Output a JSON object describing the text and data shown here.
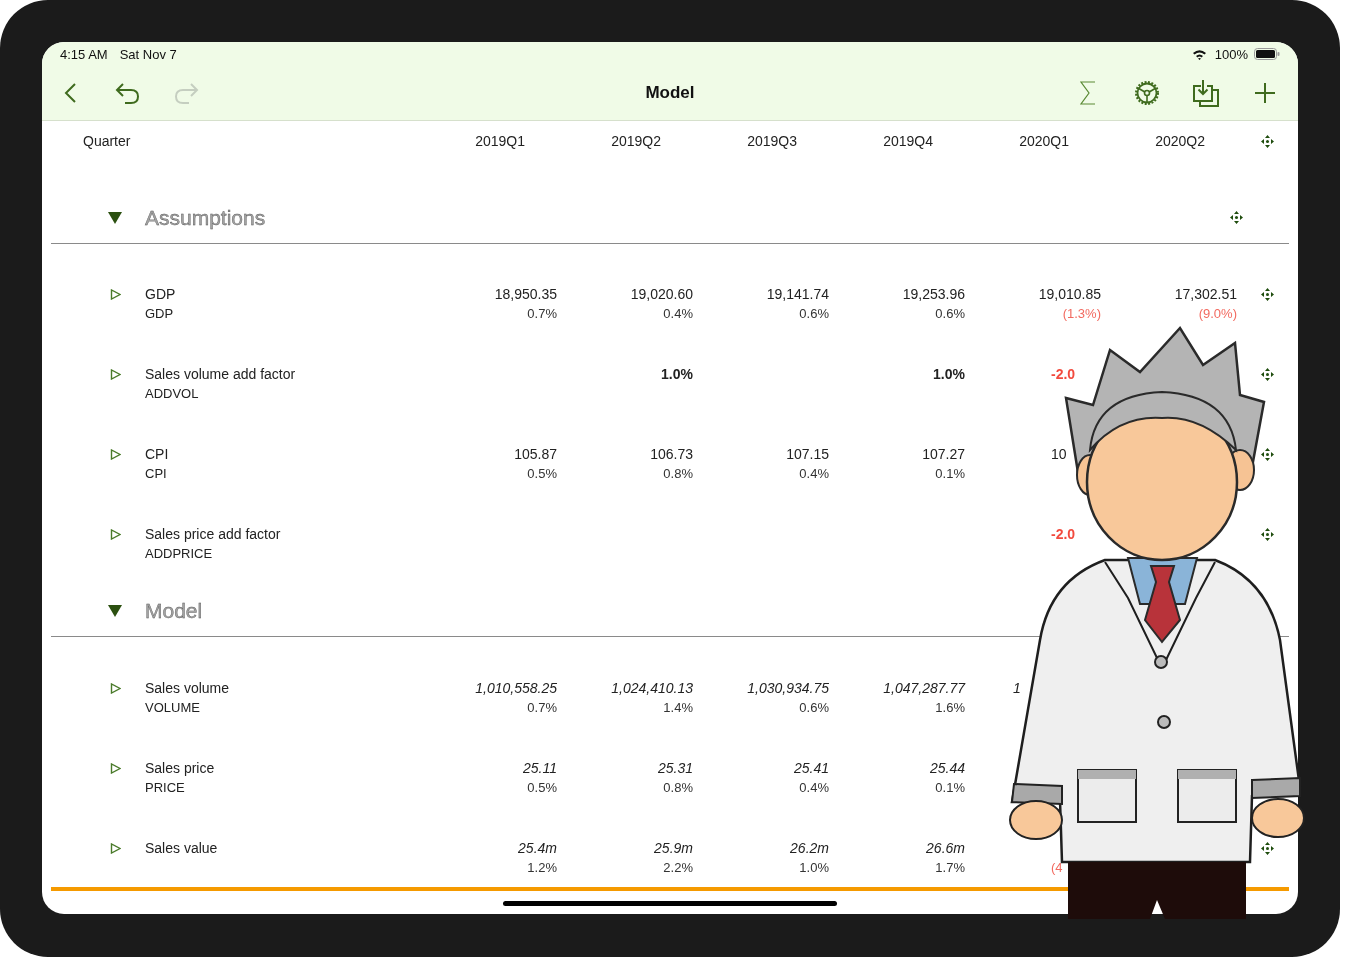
{
  "status_bar": {
    "time": "4:15 AM",
    "date": "Sat Nov 7",
    "battery": "100%"
  },
  "nav_bar": {
    "title": "Model",
    "undo": {
      "disabled": false
    },
    "redo": {
      "disabled": true
    }
  },
  "header": {
    "label": "Quarter",
    "columns": [
      "2019Q1",
      "2019Q2",
      "2019Q3",
      "2019Q4",
      "2020Q1",
      "2020Q2"
    ],
    "handle": true
  },
  "sections": [
    {
      "title": "Assumptions",
      "expanded": true,
      "handle": true,
      "rows": [
        {
          "name": "GDP",
          "code": "GDP",
          "expanded": false,
          "values_bold": false,
          "values_italic": false,
          "handle": true,
          "cells": [
            {
              "value": "18,950.35",
              "change": "0.7%"
            },
            {
              "value": "19,020.60",
              "change": "0.4%"
            },
            {
              "value": "19,141.74",
              "change": "0.6%"
            },
            {
              "value": "19,253.96",
              "change": "0.6%"
            },
            {
              "value": "19,010.85",
              "change": "(1.3%)",
              "change_negative": true
            },
            {
              "value": "17,302.51",
              "change": "(9.0%)",
              "change_negative": true
            }
          ]
        },
        {
          "name": "Sales volume add factor",
          "code": "ADDVOL",
          "expanded": false,
          "values_bold": true,
          "values_italic": false,
          "handle": true,
          "cells": [
            null,
            {
              "value": "1.0%"
            },
            null,
            {
              "value": "1.0%"
            },
            {
              "value": "-2.0",
              "value_negative": true,
              "cut": true
            },
            null
          ]
        },
        {
          "name": "CPI",
          "code": "CPI",
          "expanded": false,
          "values_bold": false,
          "values_italic": false,
          "handle": true,
          "cells": [
            {
              "value": "105.87",
              "change": "0.5%"
            },
            {
              "value": "106.73",
              "change": "0.8%"
            },
            {
              "value": "107.15",
              "change": "0.4%"
            },
            {
              "value": "107.27",
              "change": "0.1%"
            },
            {
              "value": "10",
              "cut": true
            },
            null
          ]
        },
        {
          "name": "Sales price add factor",
          "code": "ADDPRICE",
          "expanded": false,
          "values_bold": true,
          "values_italic": false,
          "handle": true,
          "cells": [
            null,
            null,
            null,
            null,
            {
              "value": "-2.0",
              "value_negative": true,
              "cut": true
            },
            null
          ]
        }
      ]
    },
    {
      "title": "Model",
      "expanded": true,
      "handle": false,
      "rows": [
        {
          "name": "Sales volume",
          "code": "VOLUME",
          "expanded": false,
          "values_bold": false,
          "values_italic": true,
          "handle": false,
          "cells": [
            {
              "value": "1,010,558.25",
              "change": "0.7%"
            },
            {
              "value": "1,024,410.13",
              "change": "1.4%"
            },
            {
              "value": "1,030,934.75",
              "change": "0.6%"
            },
            {
              "value": "1,047,287.77",
              "change": "1.6%"
            },
            {
              "value": "1",
              "cut": true
            },
            null
          ]
        },
        {
          "name": "Sales price",
          "code": "PRICE",
          "expanded": false,
          "values_bold": false,
          "values_italic": true,
          "handle": false,
          "cells": [
            {
              "value": "25.11",
              "change": "0.5%"
            },
            {
              "value": "25.31",
              "change": "0.8%"
            },
            {
              "value": "25.41",
              "change": "0.4%"
            },
            {
              "value": "25.44",
              "change": "0.1%"
            },
            null,
            null
          ]
        },
        {
          "name": "Sales value",
          "expanded": false,
          "values_bold": false,
          "values_italic": true,
          "handle": true,
          "cells": [
            {
              "value": "25.4m",
              "change": "1.2%"
            },
            {
              "value": "25.9m",
              "change": "2.2%"
            },
            {
              "value": "26.2m",
              "change": "1.0%"
            },
            {
              "value": "26.6m",
              "change": "1.7%"
            },
            {
              "change": "(4",
              "change_negative": true,
              "cut": true
            },
            null
          ]
        }
      ]
    }
  ]
}
